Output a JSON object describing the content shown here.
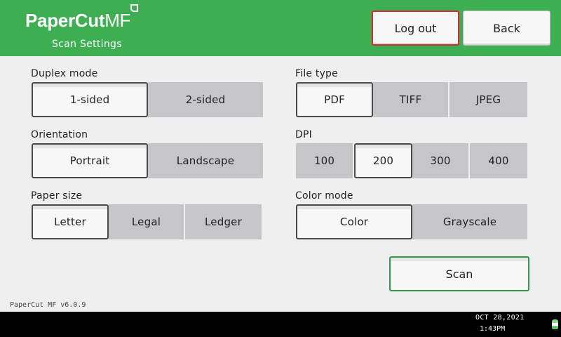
{
  "header": {
    "logo_main": "PaperCut",
    "logo_suffix": "MF",
    "subtitle": "Scan Settings",
    "logout_label": "Log out",
    "back_label": "Back",
    "accent_color": "#3daf52",
    "logout_border_color": "#d92b2b"
  },
  "duplex": {
    "label": "Duplex mode",
    "options": [
      "1-sided",
      "2-sided"
    ],
    "selected": "1-sided"
  },
  "file_type": {
    "label": "File type",
    "options": [
      "PDF",
      "TIFF",
      "JPEG"
    ],
    "selected": "PDF"
  },
  "orientation": {
    "label": "Orientation",
    "options": [
      "Portrait",
      "Landscape"
    ],
    "selected": "Portrait"
  },
  "dpi": {
    "label": "DPI",
    "options": [
      "100",
      "200",
      "300",
      "400"
    ],
    "selected": "200"
  },
  "paper_size": {
    "label": "Paper size",
    "options": [
      "Letter",
      "Legal",
      "Ledger"
    ],
    "selected": "Letter"
  },
  "color_mode": {
    "label": "Color mode",
    "options": [
      "Color",
      "Grayscale"
    ],
    "selected": "Color"
  },
  "scan_label": "Scan",
  "scan_border_color": "#2e9a48",
  "version": "PaperCut MF v6.0.9",
  "status_bar": {
    "date": "OCT  28,2021",
    "time": "1:43PM",
    "icon": "toner-status-icon"
  }
}
